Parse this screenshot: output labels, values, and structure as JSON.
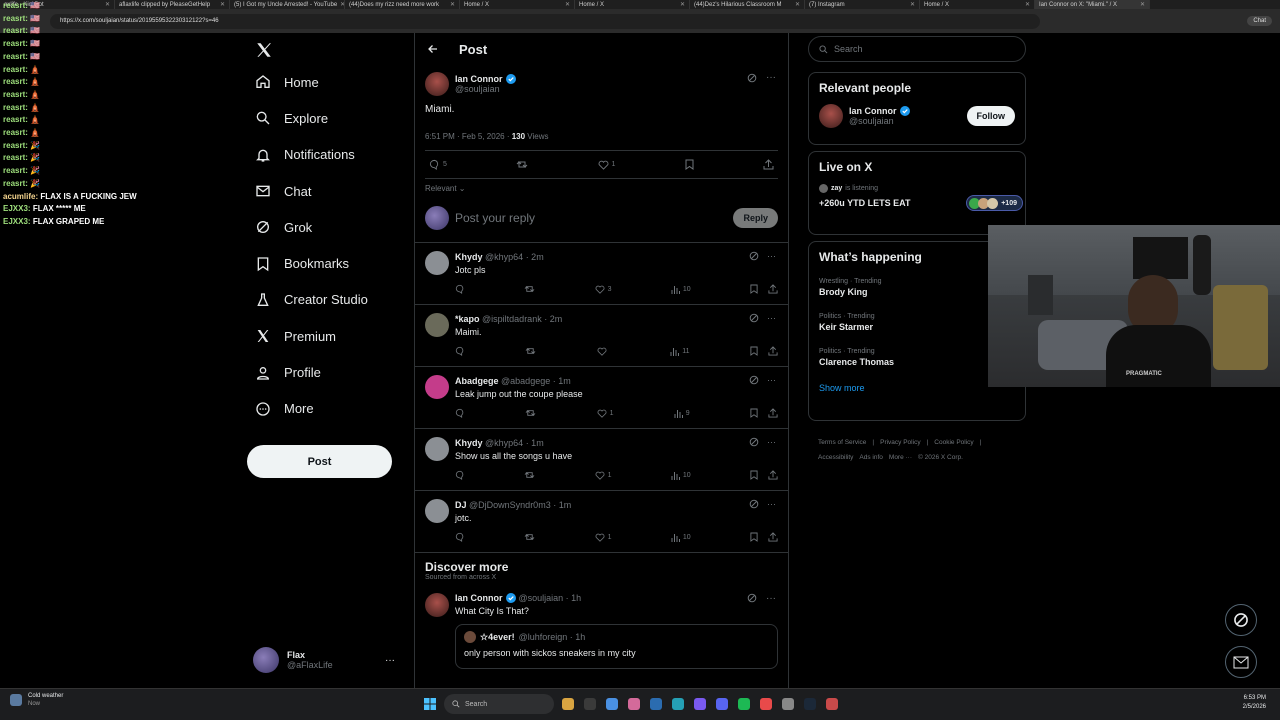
{
  "browser": {
    "tabs": [
      "axlife - KickBot",
      "aflaxlife clipped by PleaseGetHelp",
      "(5) I Got my Uncle Arrested! - YouTube",
      "(44)Does my rizz need more work",
      "Home / X",
      "Home / X",
      "(44)Dez's Hilarious Classroom M",
      "(7) Instagram",
      "Home / X",
      "Ian Connor on X: \"Miami.\" / X"
    ],
    "url": "https://x.com/souljaian/status/2019559532230312122?s=46",
    "chat_button": "Chat"
  },
  "stream_chat": [
    {
      "user": "reasrt:",
      "msg": "🇺🇸",
      "gold": false
    },
    {
      "user": "reasrt:",
      "msg": "🇺🇸",
      "gold": false
    },
    {
      "user": "reasrt:",
      "msg": "🇺🇸",
      "gold": false
    },
    {
      "user": "reasrt:",
      "msg": "🇺🇸",
      "gold": false
    },
    {
      "user": "reasrt:",
      "msg": "🇺🇸",
      "gold": false
    },
    {
      "user": "reasrt:",
      "msg": "🛕",
      "gold": false
    },
    {
      "user": "reasrt:",
      "msg": "🛕",
      "gold": false
    },
    {
      "user": "reasrt:",
      "msg": "🛕",
      "gold": false
    },
    {
      "user": "reasrt:",
      "msg": "🛕",
      "gold": false
    },
    {
      "user": "reasrt:",
      "msg": "🛕",
      "gold": false
    },
    {
      "user": "reasrt:",
      "msg": "🛕",
      "gold": false
    },
    {
      "user": "reasrt:",
      "msg": "🎉",
      "gold": false
    },
    {
      "user": "reasrt:",
      "msg": "🎉",
      "gold": false
    },
    {
      "user": "reasrt:",
      "msg": "🎉",
      "gold": false
    },
    {
      "user": "reasrt:",
      "msg": "🎉",
      "gold": false
    },
    {
      "user": "acumlife:",
      "msg": "FLAX IS A FUCKING JEW",
      "gold": true
    },
    {
      "user": "EJXX3:",
      "msg": "FLAX ***** ME",
      "gold": false
    },
    {
      "user": "EJXX3:",
      "msg": "FLAX GRAPED ME",
      "gold": false
    }
  ],
  "nav": {
    "items": [
      "Home",
      "Explore",
      "Notifications",
      "Chat",
      "Grok",
      "Bookmarks",
      "Creator Studio",
      "Premium",
      "Profile",
      "More"
    ],
    "post_button": "Post",
    "account_name": "Flax",
    "account_handle": "@aFlaxLife"
  },
  "main": {
    "header": "Post",
    "post": {
      "author": "Ian Connor",
      "handle": "@souljaian",
      "text": "Miami.",
      "time": "6:51 PM · Feb 5, 2026 · ",
      "views_count": "130",
      "views_label": " Views",
      "replies": "5",
      "likes": "1"
    },
    "sort_label": "Relevant",
    "reply_placeholder": "Post your reply",
    "reply_button": "Reply",
    "replies": [
      {
        "name": "Khydy",
        "handle": "@khyp64 · 2m",
        "text": "Jotc pls",
        "likes": "3",
        "views": "10",
        "color": "#8b8f94"
      },
      {
        "name": "*kapo",
        "handle": "@ispiltdadrank · 2m",
        "text": "Maimi.",
        "likes": "",
        "views": "11",
        "color": "#6a6a5a"
      },
      {
        "name": "Abadgege",
        "handle": "@abadgege · 1m",
        "text": "Leak jump out the coupe please",
        "likes": "1",
        "views": "9",
        "color": "#c43c8a"
      },
      {
        "name": "Khydy",
        "handle": "@khyp64 · 1m",
        "text": "Show us all the songs u have",
        "likes": "1",
        "views": "10",
        "color": "#8b8f94"
      },
      {
        "name": "DJ",
        "handle": "@DjDownSyndr0m3 · 1m",
        "text": "jotc.",
        "likes": "1",
        "views": "10",
        "color": "#8b8f94"
      }
    ],
    "discover": {
      "title": "Discover more",
      "subtitle": "Sourced from across X",
      "author": "Ian Connor",
      "handle": "@souljaian · 1h",
      "text": "What City Is That?",
      "quote_author": "☆4ever!",
      "quote_handle": "@luhforeign · 1h",
      "quote_text": "only person with sickos sneakers in my city"
    }
  },
  "right": {
    "search_placeholder": "Search",
    "relevant_title": "Relevant people",
    "rel_name": "Ian Connor",
    "rel_handle": "@souljaian",
    "follow": "Follow",
    "live_title": "Live on X",
    "live_user": "zay",
    "live_status": " is listening",
    "live_text": "+260u YTD LETS EAT",
    "live_count": "+109",
    "happening_title": "What’s happening",
    "trends": [
      {
        "cat": "Wrestling · Trending",
        "name": "Brody King"
      },
      {
        "cat": "Politics · Trending",
        "name": "Keir Starmer"
      },
      {
        "cat": "Politics · Trending",
        "name": "Clarence Thomas"
      }
    ],
    "show_more": "Show more",
    "footer1": [
      "Terms of Service",
      "|",
      "Privacy Policy",
      "|",
      "Cookie Policy",
      "|"
    ],
    "footer2": [
      "Accessibility",
      "Ads info",
      "More ···",
      "© 2026 X Corp."
    ]
  },
  "webcam_text": "PRAGMATIC",
  "taskbar": {
    "weather": "Cold weather",
    "weather_sub": "Now",
    "search": "Search",
    "time": "6:53 PM",
    "date": "2/5/2026"
  }
}
